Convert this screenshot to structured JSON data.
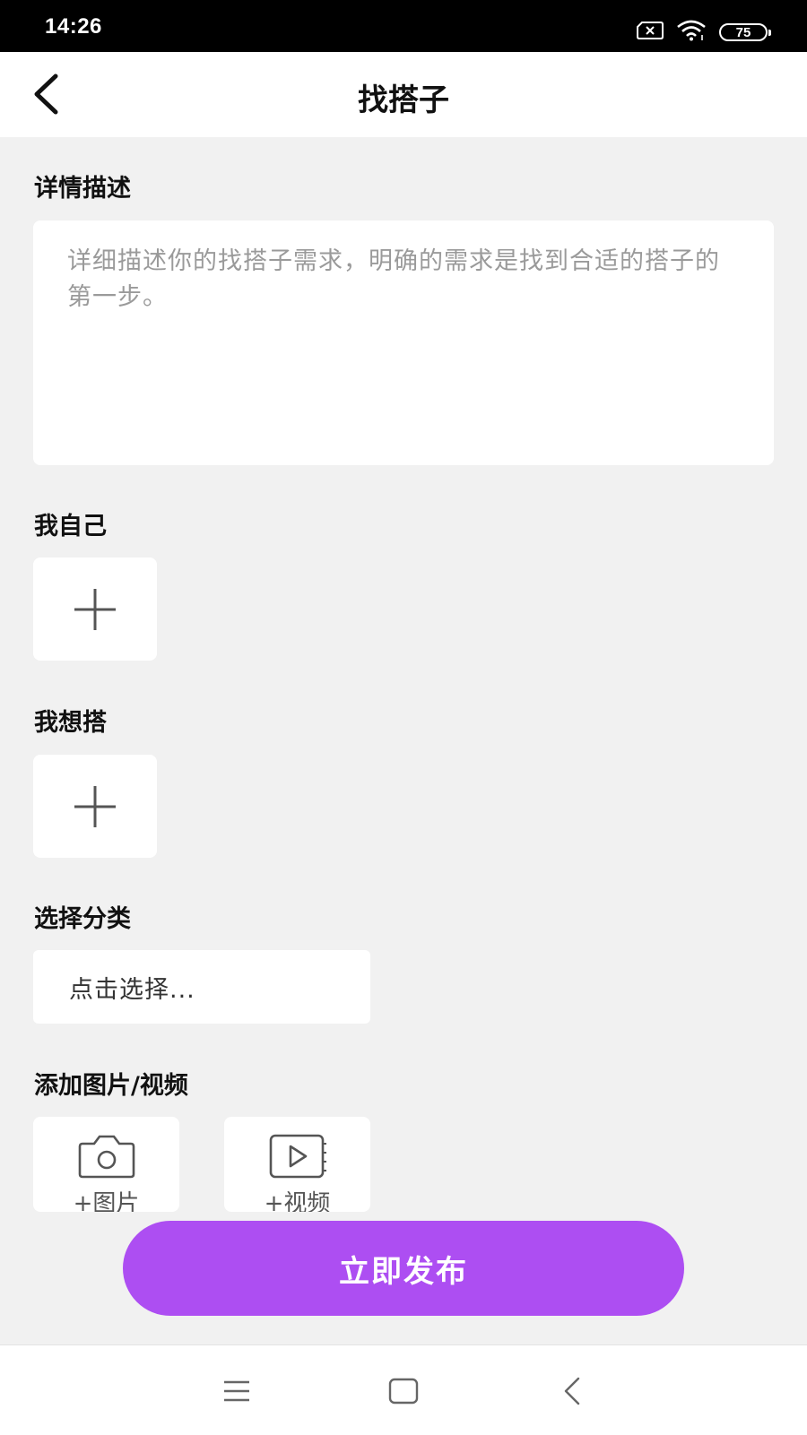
{
  "status_bar": {
    "time": "14:26",
    "battery_level": "75",
    "icons": [
      "sim-x-icon",
      "wifi-icon",
      "battery-icon"
    ]
  },
  "header": {
    "title": "找搭子",
    "back_icon": "back-arrow-icon"
  },
  "form": {
    "description": {
      "label": "详情描述",
      "placeholder": "详细描述你的找搭子需求，明确的需求是找到合适的搭子的第一步。"
    },
    "myself": {
      "label": "我自己",
      "add_icon": "plus-icon"
    },
    "want_partner": {
      "label": "我想搭",
      "add_icon": "plus-icon"
    },
    "category": {
      "label": "选择分类",
      "placeholder": "点击选择..."
    },
    "media": {
      "label": "添加图片/视频",
      "add_image_label": "+图片",
      "add_video_label": "+视频"
    }
  },
  "publish_button": {
    "label": "立即发布",
    "color": "#ad4ef2"
  },
  "system_nav": {
    "icons": [
      "menu-icon",
      "home-icon",
      "back-icon"
    ]
  }
}
